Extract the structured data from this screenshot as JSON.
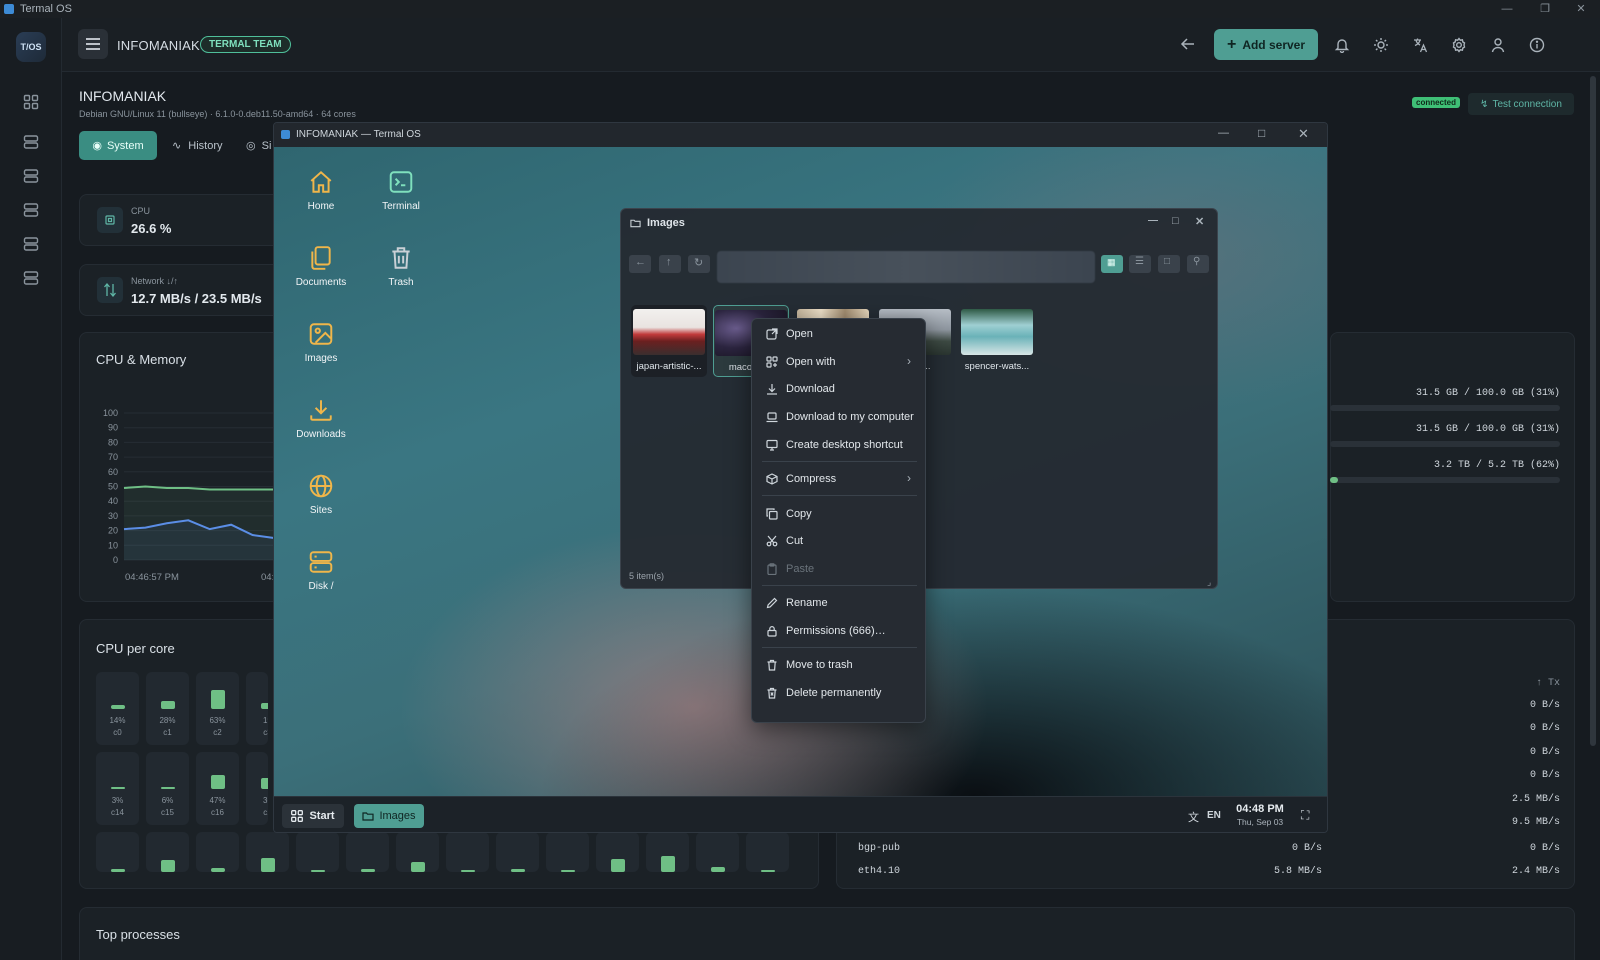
{
  "os": {
    "title": "Termal OS"
  },
  "header": {
    "server_name": "INFOMANIAK",
    "team_badge": "TERMAL TEAM",
    "add_server_label": "Add server"
  },
  "rail": {
    "brand": "T/OS"
  },
  "dashboard": {
    "title": "INFOMANIAK",
    "subtitle": "Debian GNU/Linux 11 (bullseye) · 6.1.0-0.deb11.50-amd64 · 64 cores",
    "connected_label": "connected",
    "test_connection_label": "Test connection",
    "tabs": [
      "System",
      "History",
      "Si"
    ],
    "cpu": {
      "label": "CPU",
      "value": "26.6 %"
    },
    "network": {
      "label": "Network ↓/↑",
      "value": "12.7 MB/s / 23.5 MB/s"
    },
    "cpu_memory_title": "CPU & Memory",
    "cpu_per_core_title": "CPU per core",
    "top_processes_title": "Top processes",
    "mem_rows": [
      "31.5 GB / 100.0 GB (31%)",
      "31.5 GB / 100.0 GB (31%)",
      "3.2 TB / 5.2 TB (62%)"
    ],
    "tx_header": "↑ Tx",
    "tx_values": [
      "0 B/s",
      "0 B/s",
      "0 B/s",
      "0 B/s",
      "2.5 MB/s",
      "9.5 MB/s",
      "0 B/s",
      "2.4 MB/s"
    ],
    "iface_rows": [
      {
        "name": "bgp-pub",
        "rx": "0 B/s"
      },
      {
        "name": "eth4.10",
        "rx": "5.8 MB/s"
      }
    ],
    "cores": [
      {
        "pct": "14%",
        "label": "c0",
        "value": 14
      },
      {
        "pct": "28%",
        "label": "c1",
        "value": 28
      },
      {
        "pct": "63%",
        "label": "c2",
        "value": 63
      },
      {
        "pct": "19",
        "label": "c3",
        "value": 19
      },
      {
        "pct": "3%",
        "label": "c14",
        "value": 3
      },
      {
        "pct": "6%",
        "label": "c15",
        "value": 6
      },
      {
        "pct": "47%",
        "label": "c16",
        "value": 47
      },
      {
        "pct": "36",
        "label": "c1",
        "value": 36
      }
    ]
  },
  "chart_data": {
    "type": "line",
    "title": "CPU & Memory",
    "x": [
      "04:46:57 PM",
      "04:47:"
    ],
    "ylim": [
      0,
      100
    ],
    "yticks": [
      100,
      90,
      80,
      70,
      60,
      50,
      40,
      30,
      20,
      10,
      0
    ],
    "series": [
      {
        "color": "#6fbf85",
        "values": [
          49,
          50,
          49,
          49,
          48,
          48,
          48,
          48
        ]
      },
      {
        "color": "#5b8ee6",
        "values": [
          21,
          22,
          25,
          27,
          21,
          24,
          17,
          15
        ]
      }
    ]
  },
  "window": {
    "title": "INFOMANIAK — Termal OS",
    "desktop_icons": [
      {
        "name": "home",
        "label": "Home"
      },
      {
        "name": "terminal",
        "label": "Terminal"
      },
      {
        "name": "documents",
        "label": "Documents"
      },
      {
        "name": "trash",
        "label": "Trash"
      },
      {
        "name": "images",
        "label": "Images"
      },
      {
        "name": "downloads",
        "label": "Downloads"
      },
      {
        "name": "sites",
        "label": "Sites"
      },
      {
        "name": "disk",
        "label": "Disk /"
      }
    ],
    "taskbar": {
      "start_label": "Start",
      "images_label": "Images",
      "lang": "EN",
      "time": "04:48 PM",
      "date": "Thu, Sep 03"
    }
  },
  "file_window": {
    "title": "Images",
    "status": "5 item(s)",
    "files": [
      {
        "name": "japan-artistic-..."
      },
      {
        "name": "macos-2..."
      },
      {
        "name": ""
      },
      {
        "name": "...nes..."
      },
      {
        "name": "spencer-wats..."
      }
    ]
  },
  "context_menu": {
    "items": [
      {
        "label": "Open",
        "icon": "external-link-icon"
      },
      {
        "label": "Open with",
        "icon": "apps-icon",
        "submenu": true
      },
      {
        "label": "Download",
        "icon": "download-icon"
      },
      {
        "label": "Download to my computer",
        "icon": "laptop-icon"
      },
      {
        "label": "Create desktop shortcut",
        "icon": "monitor-icon"
      },
      {
        "label": "Compress",
        "icon": "box-icon",
        "submenu": true
      },
      {
        "label": "Copy",
        "icon": "copy-icon"
      },
      {
        "label": "Cut",
        "icon": "scissors-icon"
      },
      {
        "label": "Paste",
        "icon": "clipboard-icon",
        "disabled": true
      },
      {
        "label": "Rename",
        "icon": "pencil-icon"
      },
      {
        "label": "Permissions (666)…",
        "icon": "lock-icon"
      },
      {
        "label": "Move to trash",
        "icon": "trash-icon"
      },
      {
        "label": "Delete permanently",
        "icon": "trash-x-icon"
      }
    ]
  }
}
